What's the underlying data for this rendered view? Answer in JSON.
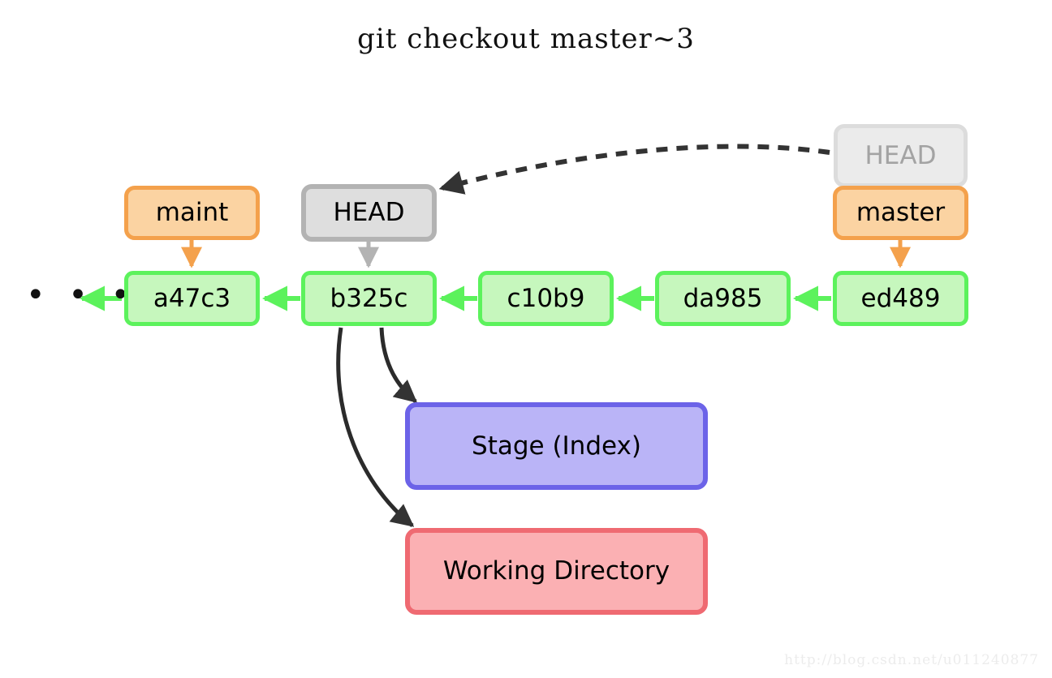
{
  "title": "git checkout master~3",
  "ellipsis": "• • •",
  "commits": [
    {
      "id": "a47c3",
      "label": "a47c3"
    },
    {
      "id": "b325c",
      "label": "b325c"
    },
    {
      "id": "c10b9",
      "label": "c10b9"
    },
    {
      "id": "da985",
      "label": "da985"
    },
    {
      "id": "ed489",
      "label": "ed489"
    }
  ],
  "refs": {
    "maint": "maint",
    "head_active": "HEAD",
    "head_faded": "HEAD",
    "master": "master"
  },
  "areas": {
    "stage": "Stage (Index)",
    "working_directory": "Working Directory"
  },
  "watermark": "http://blog.csdn.net/u011240877",
  "colors": {
    "commit_fill": "#c6f7bd",
    "commit_border": "#5cf25c",
    "ref_fill": "#fbd3a2",
    "ref_border": "#f4a14c",
    "head_fill": "#dedede",
    "head_border": "#b3b3b3",
    "head_faded_fill": "#ebebeb",
    "head_faded_border": "#dcdcdc",
    "head_faded_text": "#a3a3a3",
    "stage_fill": "#bab4f7",
    "stage_border": "#6c63e8",
    "working_fill": "#fbb0b3",
    "working_border": "#ef6a72",
    "arrow_dark": "#333333",
    "background": "#ffffff"
  }
}
